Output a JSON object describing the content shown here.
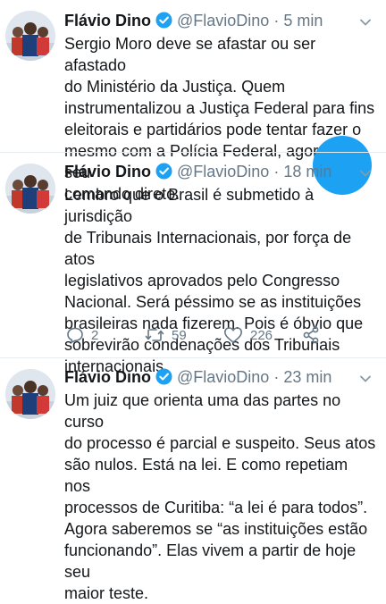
{
  "colors": {
    "accent": "#1da1f2",
    "text": "#14171a",
    "muted": "#657786",
    "divider": "#e6ecf0"
  },
  "tweets": [
    {
      "author": "Flávio Dino",
      "handle": "@FlavioDino",
      "time": "5 min",
      "lines": [
        "Sergio Moro deve se afastar ou ser afastado",
        "do Ministério da Justiça. Quem",
        "instrumentalizou a Justiça Federal para fins",
        "eleitorais e partidários pode tentar fazer o",
        "mesmo com a Polícia Federal, agora sob seu",
        "comando direto."
      ]
    },
    {
      "author": "Flávio Dino",
      "handle": "@FlavioDino",
      "time": "18 min",
      "lines": [
        "Lembro que o Brasil é submetido à jurisdição",
        "de Tribunais Internacionais, por força de atos",
        "legislativos aprovados pelo Congresso",
        "Nacional. Será péssimo se as instituições",
        "brasileiras nada fizerem. Pois é óbvio que",
        "sobrevirão condenações dos Tribunais",
        "internacionais."
      ],
      "actions": {
        "replies": "2",
        "retweets": "59",
        "likes": "226"
      }
    },
    {
      "author": "Flávio Dino",
      "handle": "@FlavioDino",
      "time": "23 min",
      "lines": [
        "Um juiz que orienta uma das partes no curso",
        "do processo é parcial e suspeito. Seus atos",
        "são nulos. Está na lei. E como repetiam nos",
        "processos de Curitiba: “a lei é para todos”.",
        "Agora saberemos se “as instituições estão",
        "funcionando”. Elas vivem a partir de hoje seu",
        "maior teste."
      ]
    }
  ],
  "icons": {
    "verified": "verified-badge-icon",
    "caret": "chevron-down-icon",
    "reply": "reply-icon",
    "retweet": "retweet-icon",
    "like": "heart-icon",
    "share": "share-icon"
  }
}
